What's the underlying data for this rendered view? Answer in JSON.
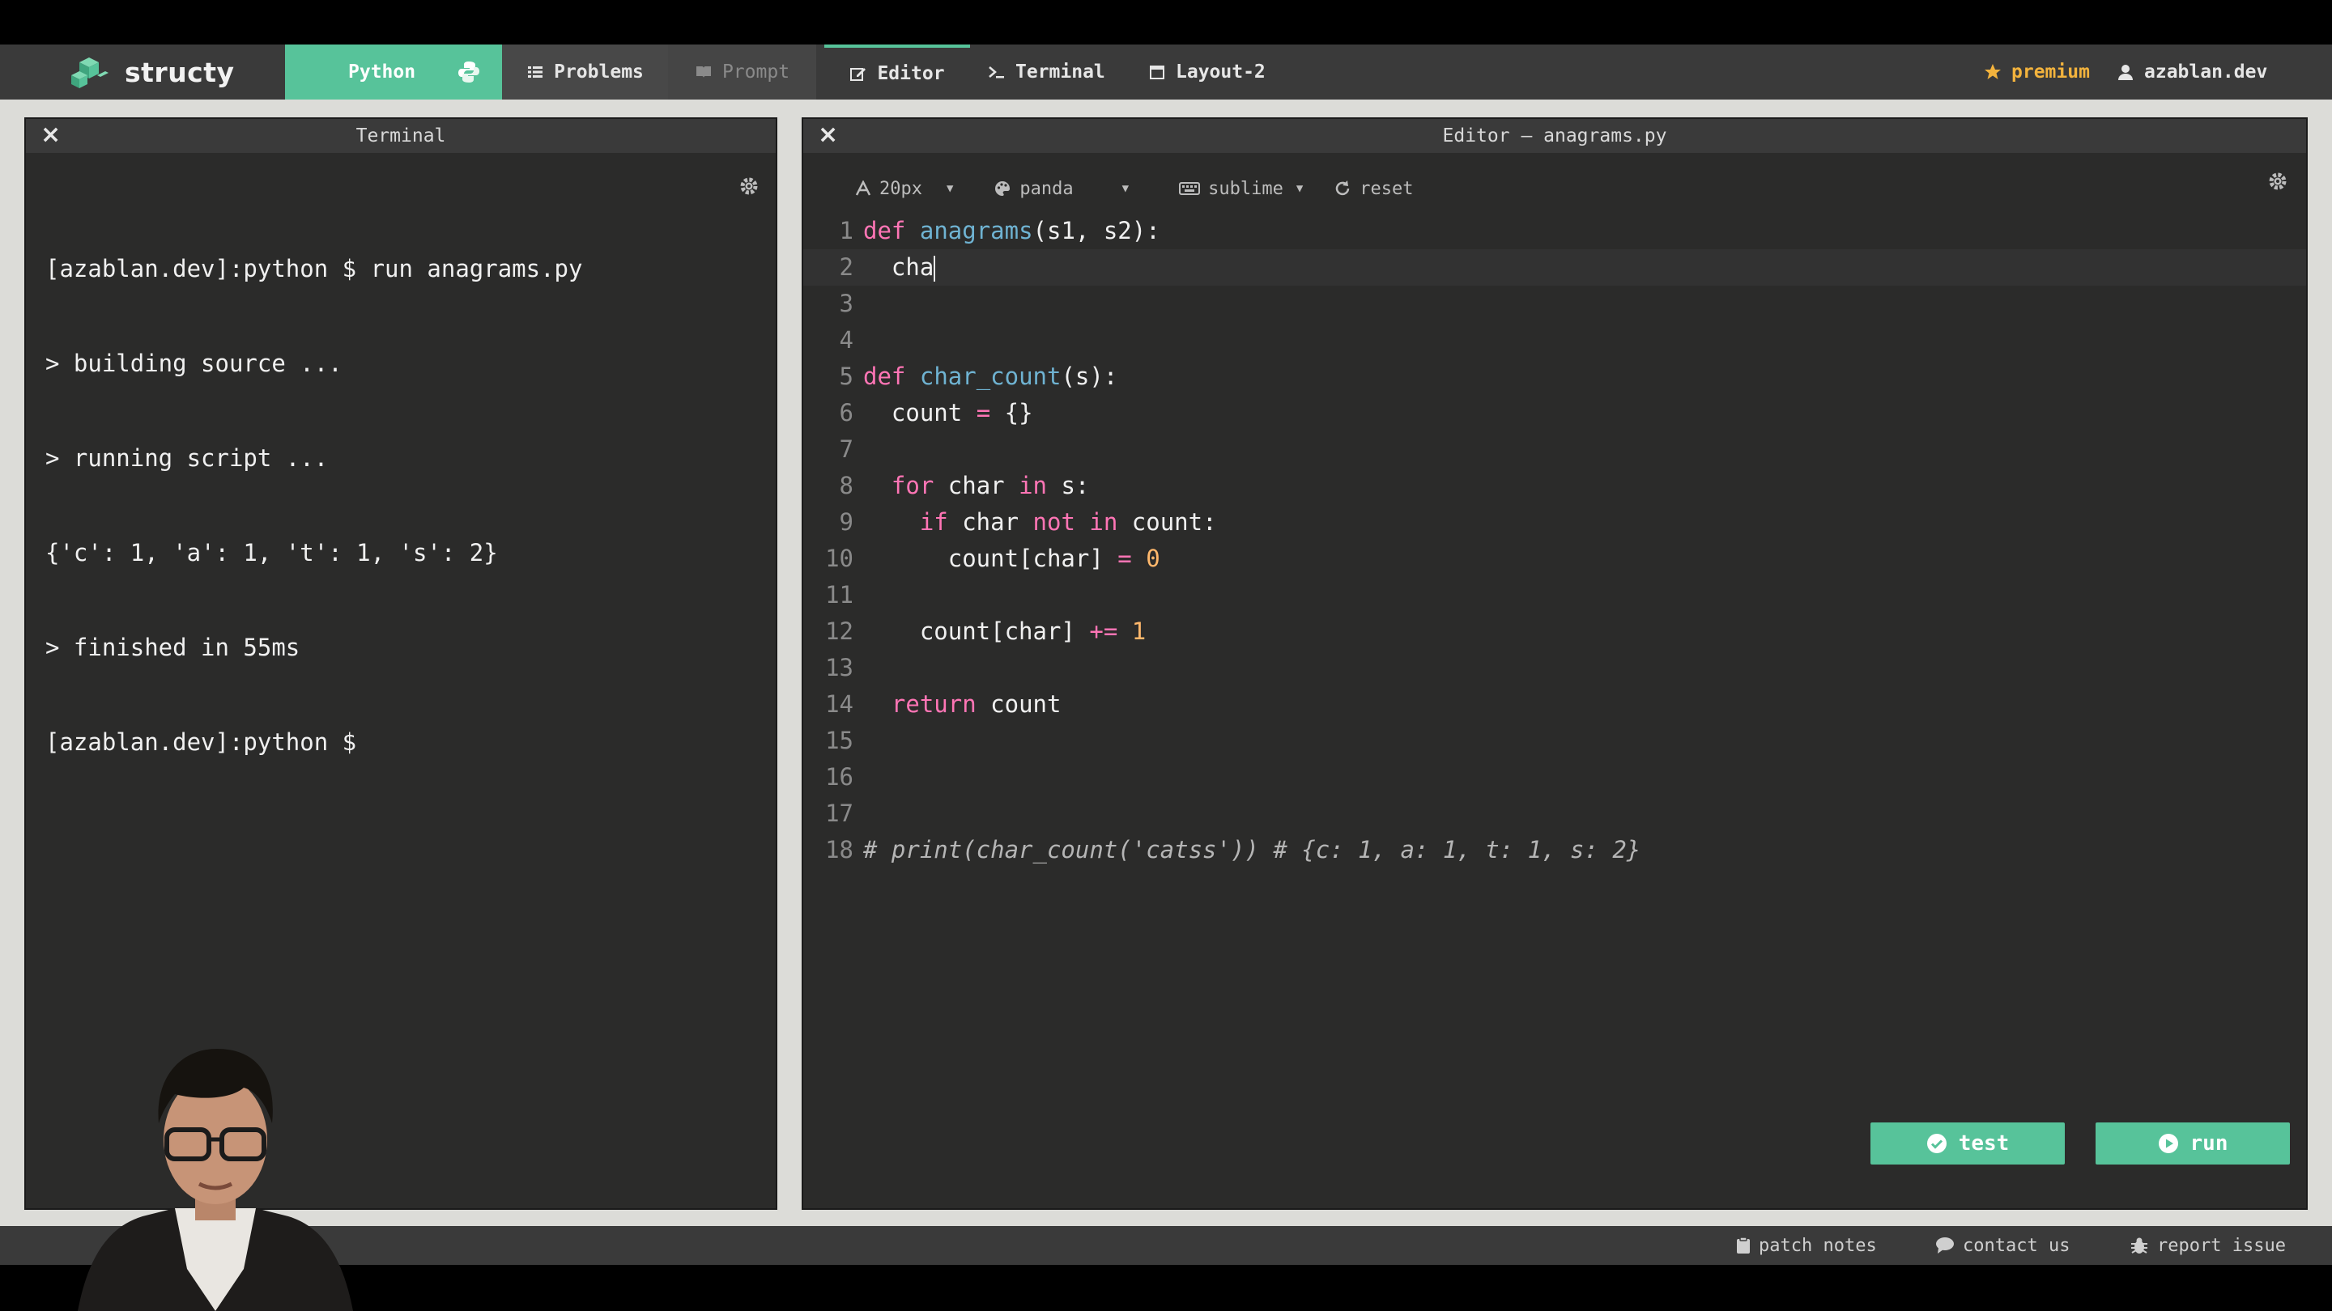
{
  "app": {
    "name": "structy"
  },
  "nav": {
    "language": "Python",
    "problems": "Problems",
    "prompt": "Prompt",
    "editor": "Editor",
    "terminal": "Terminal",
    "layout": "Layout-2",
    "premium": "premium",
    "user": "azablan.dev"
  },
  "terminal": {
    "title": "Terminal",
    "lines": [
      "[azablan.dev]:python $ run anagrams.py",
      "> building source ...",
      "> running script ...",
      "{'c': 1, 'a': 1, 't': 1, 's': 2}",
      "> finished in 55ms",
      "[azablan.dev]:python $"
    ]
  },
  "editor": {
    "title": "Editor — anagrams.py",
    "toolbar": {
      "font_size": "20px",
      "theme": "panda",
      "keymap": "sublime",
      "reset": "reset"
    },
    "active_line": 2,
    "lines": [
      [
        [
          "kw",
          "def"
        ],
        [
          "t",
          " "
        ],
        [
          "fn",
          "anagrams"
        ],
        [
          "t",
          "(s1, s2):"
        ]
      ],
      [
        [
          "t",
          "  cha"
        ],
        [
          "caret",
          ""
        ]
      ],
      [],
      [],
      [
        [
          "kw",
          "def"
        ],
        [
          "t",
          " "
        ],
        [
          "fn",
          "char_count"
        ],
        [
          "t",
          "(s):"
        ]
      ],
      [
        [
          "t",
          "  count "
        ],
        [
          "op",
          "="
        ],
        [
          "t",
          " {}"
        ]
      ],
      [],
      [
        [
          "t",
          "  "
        ],
        [
          "kw",
          "for"
        ],
        [
          "t",
          " char "
        ],
        [
          "kw",
          "in"
        ],
        [
          "t",
          " s:"
        ]
      ],
      [
        [
          "t",
          "    "
        ],
        [
          "kw",
          "if"
        ],
        [
          "t",
          " char "
        ],
        [
          "kw",
          "not"
        ],
        [
          "t",
          " "
        ],
        [
          "kw",
          "in"
        ],
        [
          "t",
          " count:"
        ]
      ],
      [
        [
          "t",
          "      count[char] "
        ],
        [
          "op",
          "="
        ],
        [
          "t",
          " "
        ],
        [
          "num",
          "0"
        ]
      ],
      [],
      [
        [
          "t",
          "    count[char] "
        ],
        [
          "op",
          "+="
        ],
        [
          "t",
          " "
        ],
        [
          "num",
          "1"
        ]
      ],
      [],
      [
        [
          "t",
          "  "
        ],
        [
          "kw",
          "return"
        ],
        [
          "t",
          " count"
        ]
      ],
      [],
      [],
      [],
      [
        [
          "cmt",
          "# print(char_count('catss')) # {c: 1, a: 1, t: 1, s: 2}"
        ]
      ]
    ],
    "buttons": {
      "test": "test",
      "run": "run"
    }
  },
  "footer": {
    "patch_notes": "patch notes",
    "contact_us": "contact us",
    "report_issue": "report issue"
  },
  "colors": {
    "accent": "#57c39a",
    "premium": "#f3b33d",
    "keyword": "#ff75b5",
    "function": "#6fb3d2",
    "number": "#ffb86c"
  }
}
